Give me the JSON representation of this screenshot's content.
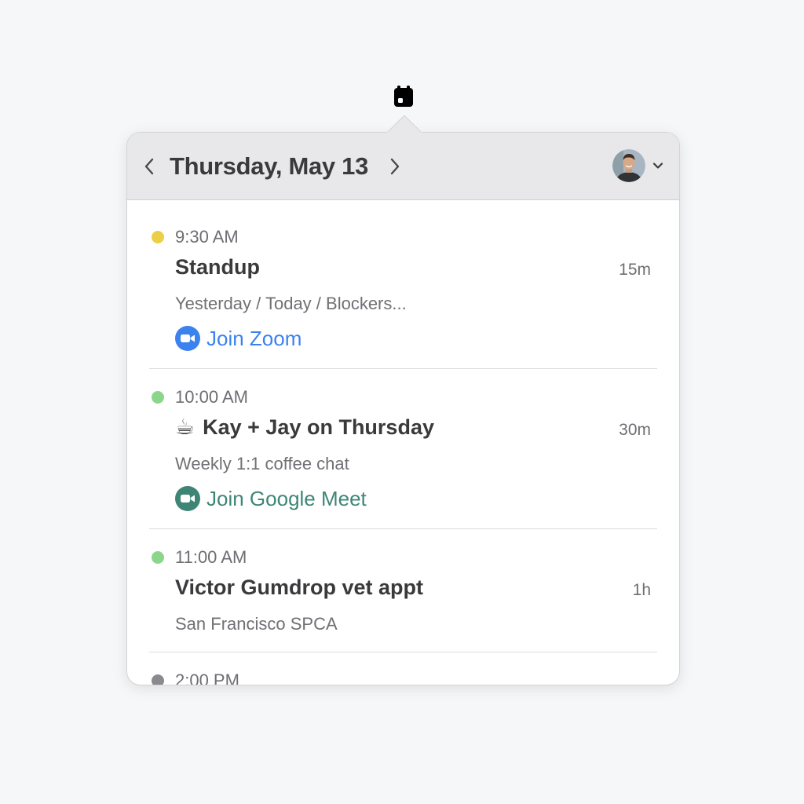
{
  "menubar": {
    "icon": "calendar-icon"
  },
  "header": {
    "date": "Thursday, May 13",
    "prev_icon": "chevron-left-icon",
    "next_icon": "chevron-right-icon",
    "account_icon": "chevron-down-icon"
  },
  "events": [
    {
      "time": "9:30 AM",
      "dot_color": "#ebd046",
      "title": "Standup",
      "duration": "15m",
      "subtitle": "Yesterday / Today / Blockers...",
      "join_label": "Join Zoom",
      "join_color": "#3b82ee"
    },
    {
      "time": "10:00 AM",
      "dot_color": "#8bd68b",
      "emoji": "☕",
      "title": "Kay + Jay on Thursday",
      "duration": "30m",
      "subtitle": "Weekly 1:1 coffee chat",
      "join_label": "Join Google Meet",
      "join_color": "#3f8576"
    },
    {
      "time": "11:00 AM",
      "dot_color": "#8bd68b",
      "title": "Victor Gumdrop vet appt",
      "duration": "1h",
      "subtitle": "San Francisco SPCA"
    },
    {
      "time": "2:00 PM",
      "dot_color": "#8a8a8e"
    }
  ]
}
